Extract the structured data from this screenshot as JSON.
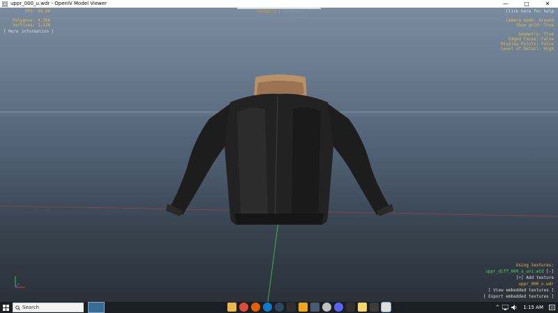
{
  "window": {
    "title": "uppr_000_u.wdr - OpenIV Model Viewer",
    "minimize_glyph": "—",
    "maximize_glyph": "□",
    "close_glyph": "✕"
  },
  "hud": {
    "fps": "FPS: 60.04",
    "polygons": "Polygons: 4,366",
    "vertices": "Vertices: 3,438",
    "more_info": "[ More information ]",
    "mode_active": "Geometry",
    "mode_separator": "|",
    "mode_inactive": "Skeleton",
    "help": "Click here for help",
    "camera_mode": "Camera mode: Around",
    "show_grid": "Show grid: True",
    "geometry": "Geometry: True",
    "edged_faces": "Edged Faces: False",
    "display_points": "Display Points: False",
    "level_of_detail": "Level of Detail: High"
  },
  "textures": {
    "heading": "Using textures:",
    "texture_file": "uppr_diff_000_a_uni.wtd",
    "remove": "[-]",
    "add": "[+] Add texture",
    "model_file": "uppr_000_u.wdr",
    "view_embedded": "[ View embedded textures ]",
    "export_embedded": "[ Export embedded textures ]"
  },
  "taskbar": {
    "search_label": "Search",
    "clock": "1:15 AM",
    "tray_arrow": "^"
  },
  "colors": {
    "hud_text": "#e8b84a",
    "texture_green": "#58d058",
    "taskbar_bg": "#1b1f24"
  }
}
